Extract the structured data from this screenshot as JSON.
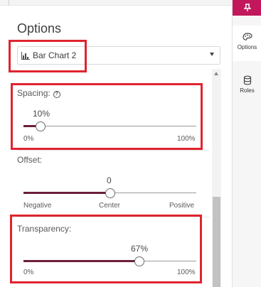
{
  "panel": {
    "title": "Options",
    "dropdown": {
      "value": "Bar Chart 2",
      "icon": "bar-chart-icon"
    }
  },
  "spacing": {
    "label": "Spacing:",
    "help_icon": "help-icon",
    "value_label": "10%",
    "value": 0.1,
    "min_label": "0%",
    "max_label": "100%"
  },
  "offset": {
    "label": "Offset:",
    "value_label": "0",
    "value": 0.5,
    "min_label": "Negative",
    "mid_label": "Center",
    "max_label": "Positive"
  },
  "transparency": {
    "label": "Transparency:",
    "value_label": "67%",
    "value": 0.67,
    "min_label": "0%",
    "max_label": "100%"
  },
  "rail": {
    "pin_icon": "pin-icon",
    "items": [
      {
        "label": "Options",
        "icon": "palette-icon",
        "active": true
      },
      {
        "label": "Roles",
        "icon": "database-icon",
        "active": false
      }
    ]
  },
  "colors": {
    "accent": "#c2185b",
    "slider_fill": "#6b1f3c",
    "highlight": "#e0242e"
  }
}
